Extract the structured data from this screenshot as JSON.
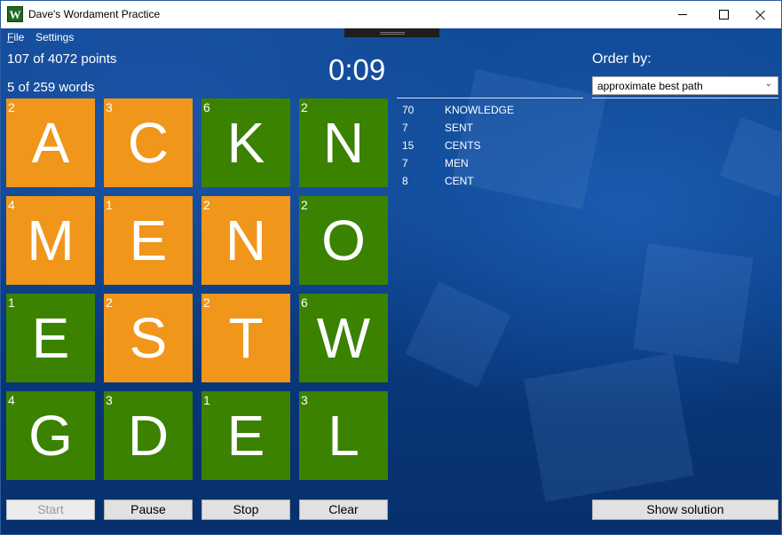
{
  "window": {
    "title": "Dave's Wordament Practice",
    "icon_letter": "W"
  },
  "menu": {
    "file_mnemonic": "F",
    "file_rest": "ile",
    "settings": "Settings"
  },
  "stats": {
    "points_text": "107 of 4072 points",
    "words_text": "5 of 259 words",
    "timer": "0:09"
  },
  "board": {
    "tiles": [
      {
        "letter": "A",
        "score": "2",
        "color": "orange"
      },
      {
        "letter": "C",
        "score": "3",
        "color": "orange"
      },
      {
        "letter": "K",
        "score": "6",
        "color": "green"
      },
      {
        "letter": "N",
        "score": "2",
        "color": "green"
      },
      {
        "letter": "M",
        "score": "4",
        "color": "orange"
      },
      {
        "letter": "E",
        "score": "1",
        "color": "orange"
      },
      {
        "letter": "N",
        "score": "2",
        "color": "orange"
      },
      {
        "letter": "O",
        "score": "2",
        "color": "green"
      },
      {
        "letter": "E",
        "score": "1",
        "color": "green"
      },
      {
        "letter": "S",
        "score": "2",
        "color": "orange"
      },
      {
        "letter": "T",
        "score": "2",
        "color": "orange"
      },
      {
        "letter": "W",
        "score": "6",
        "color": "green"
      },
      {
        "letter": "G",
        "score": "4",
        "color": "green"
      },
      {
        "letter": "D",
        "score": "3",
        "color": "green"
      },
      {
        "letter": "E",
        "score": "1",
        "color": "green"
      },
      {
        "letter": "L",
        "score": "3",
        "color": "green"
      }
    ]
  },
  "found_words": [
    {
      "points": "70",
      "word": "KNOWLEDGE"
    },
    {
      "points": "7",
      "word": "SENT"
    },
    {
      "points": "15",
      "word": "CENTS"
    },
    {
      "points": "7",
      "word": "MEN"
    },
    {
      "points": "8",
      "word": "CENT"
    }
  ],
  "order": {
    "label": "Order by:",
    "selected": "approximate best path"
  },
  "buttons": {
    "start": "Start",
    "pause": "Pause",
    "stop": "Stop",
    "clear": "Clear",
    "show_solution": "Show solution"
  },
  "colors": {
    "orange_tile": "#f0961b",
    "green_tile": "#3a8200",
    "background": "#0b3a7a"
  }
}
